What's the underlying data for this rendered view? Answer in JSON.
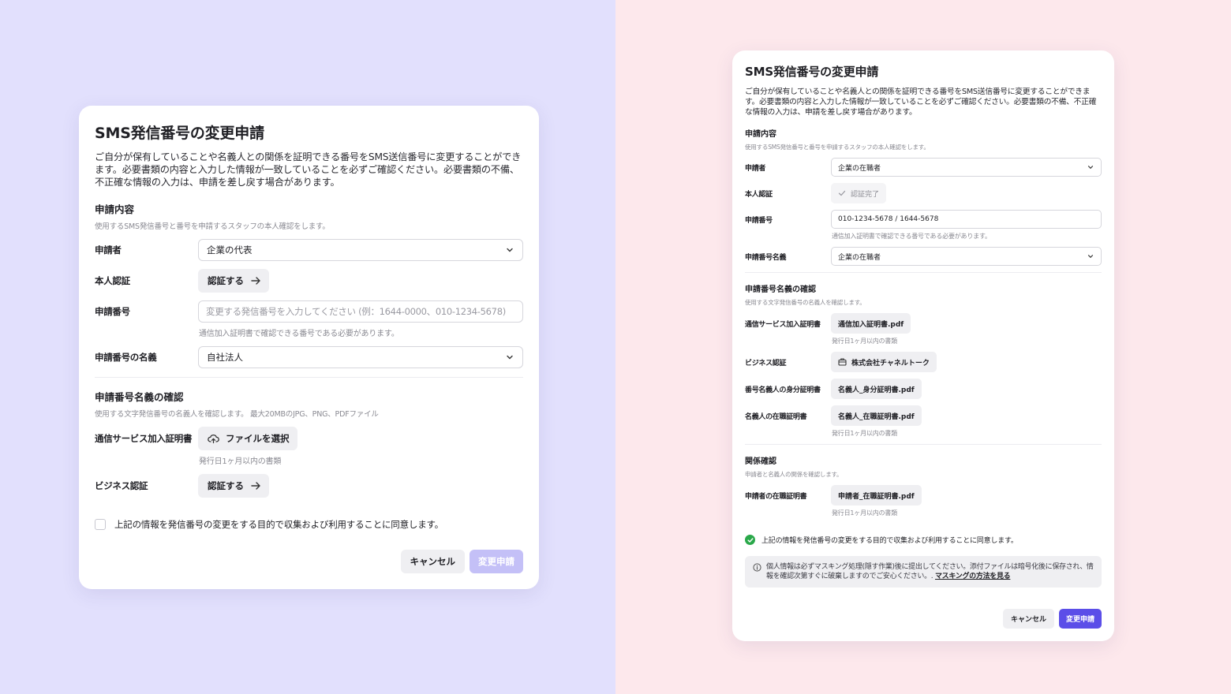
{
  "left": {
    "title": "SMS発信番号の変更申請",
    "description": "ご自分が保有していることや名義人との関係を証明できる番号をSMS送信番号に変更することができます。必要書類の内容と入力した情報が一致していることを必ずご確認ください。必要書類の不備、不正確な情報の入力は、申請を差し戻す場合があります。",
    "section1": {
      "title": "申請内容",
      "subtitle": "使用するSMS発信番号と番号を申請するスタッフの本人確認をします。",
      "applicant_label": "申請者",
      "applicant_value": "企業の代表",
      "verify_label": "本人認証",
      "verify_button": "認証する",
      "number_label": "申請番号",
      "number_placeholder": "変更する発信番号を入力してください (例：1644-0000、010-1234-5678)",
      "number_hint": "通信加入証明書で確認できる番号である必要があります。",
      "owner_label": "申請番号の名義",
      "owner_value": "自社法人"
    },
    "section2": {
      "title": "申請番号名義の確認",
      "subtitle": "使用する文字発信番号の名義人を確認します。 最大20MBのJPG、PNG、PDFファイル",
      "telecom_label": "通信サービス加入証明書",
      "file_button": "ファイルを選択",
      "telecom_hint": "発行日1ヶ月以内の書類",
      "business_label": "ビジネス認証",
      "business_button": "認証する"
    },
    "consent": "上記の情報を発信番号の変更をする目的で収集および利用することに同意します。",
    "cancel": "キャンセル",
    "submit": "変更申請"
  },
  "right": {
    "title": "SMS発信番号の変更申請",
    "description": "ご自分が保有していることや名義人との関係を証明できる番号をSMS送信番号に変更することができます。必要書類の内容と入力した情報が一致していることを必ずご確認ください。必要書類の不備、不正確な情報の入力は、申請を差し戻す場合があります。",
    "section1": {
      "title": "申請内容",
      "subtitle": "使用するSMS発信番号と番号を申請するスタッフの本人確認をします。",
      "applicant_label": "申請者",
      "applicant_value": "企業の在職者",
      "verify_label": "本人認証",
      "verify_done": "認証完了",
      "number_label": "申請番号",
      "number_value": "010-1234-5678 / 1644-5678",
      "number_hint": "通信加入証明書で確認できる番号である必要があります。",
      "owner_label": "申請番号名義",
      "owner_value": "企業の在職者"
    },
    "section2": {
      "title": "申請番号名義の確認",
      "subtitle": "使用する文字発信番号の名義人を確認します。",
      "telecom_label": "通信サービス加入証明書",
      "telecom_file": "通信加入証明書.pdf",
      "telecom_hint": "発行日1ヶ月以内の書類",
      "business_label": "ビジネス認証",
      "business_value": "株式会社チャネルトーク",
      "id_label": "番号名義人の身分証明書",
      "id_file": "名義人_身分証明書.pdf",
      "employ_label": "名義人の在職証明書",
      "employ_file": "名義人_在職証明書.pdf",
      "employ_hint": "発行日1ヶ月以内の書類"
    },
    "section3": {
      "title": "関係確認",
      "subtitle": "申請者と名義人の関係を確認します。",
      "applicant_employ_label": "申請者の在職証明書",
      "applicant_employ_file": "申請者_在職証明書.pdf",
      "applicant_employ_hint": "発行日1ヶ月以内の書類"
    },
    "consent": "上記の情報を発信番号の変更をする目的で収集および利用することに同意します。",
    "notice": "個人情報は必ずマスキング処理(隠す作業)後に提出してください。添付ファイルは暗号化後に保存され、情報を確認次第すぐに破棄しますのでご安心ください。.",
    "notice_link": "マスキングの方法を見る",
    "cancel": "キャンセル",
    "submit": "変更申請"
  },
  "colors": {
    "left_bg": "#e2e0fd",
    "right_bg": "#fde8ec",
    "primary": "#5b4ee8",
    "primary_disabled": "#c4c0f7",
    "success": "#2aa84a"
  }
}
